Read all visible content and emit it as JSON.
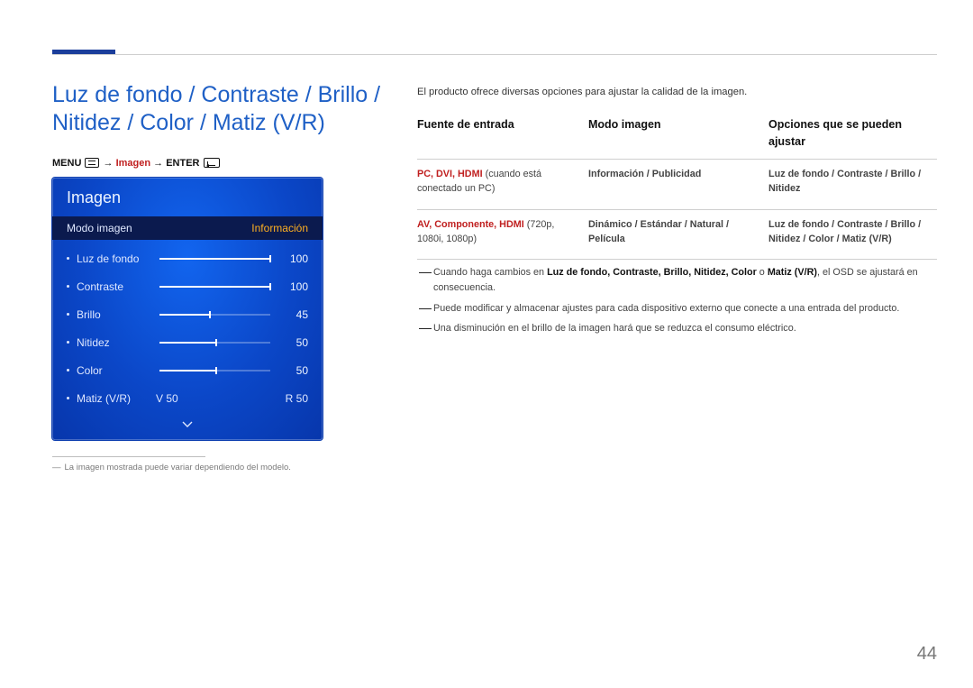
{
  "title": "Luz de fondo / Contraste / Brillo / Nitidez / Color / Matiz (V/R)",
  "breadcrumb": {
    "menu": "MENU",
    "mid": "Imagen",
    "enter": "ENTER",
    "arrow": "→"
  },
  "osd": {
    "header": "Imagen",
    "mode_label": "Modo imagen",
    "mode_value": "Información",
    "rows": [
      {
        "label": "Luz de fondo",
        "value": "100",
        "fill": 100
      },
      {
        "label": "Contraste",
        "value": "100",
        "fill": 100
      },
      {
        "label": "Brillo",
        "value": "45",
        "fill": 45
      },
      {
        "label": "Nitidez",
        "value": "50",
        "fill": 50
      },
      {
        "label": "Color",
        "value": "50",
        "fill": 50
      }
    ],
    "matiz": {
      "label": "Matiz (V/R)",
      "left": "V 50",
      "right": "R 50"
    }
  },
  "footnote": "La imagen mostrada puede variar dependiendo del modelo.",
  "intro": "El producto ofrece diversas opciones para ajustar la calidad de la imagen.",
  "table": {
    "headers": [
      "Fuente de entrada",
      "Modo imagen",
      "Opciones que se pueden ajustar"
    ],
    "rows": [
      {
        "c1": {
          "bold": "PC, DVI, HDMI",
          "rest": " (cuando está conectado un PC)"
        },
        "c2": "Información / Publicidad",
        "c3": "Luz de fondo / Contraste / Brillo / Nitidez"
      },
      {
        "c1": {
          "bold": "AV, Componente, HDMI",
          "rest": " (720p, 1080i, 1080p)"
        },
        "c2": "Dinámico / Estándar / Natural / Película",
        "c3": "Luz de fondo / Contraste / Brillo / Nitidez / Color / Matiz (V/R)"
      }
    ]
  },
  "notes": {
    "n1a": "Cuando haga cambios en ",
    "n1b": "Luz de fondo, Contraste, Brillo, Nitidez, Color",
    "n1c": " o ",
    "n1d": "Matiz (V/R)",
    "n1e": ", el OSD se ajustará en consecuencia.",
    "n2": "Puede modificar y almacenar ajustes para cada dispositivo externo que conecte a una entrada del producto.",
    "n3": "Una disminución en el brillo de la imagen hará que se reduzca el consumo eléctrico."
  },
  "page_number": "44"
}
